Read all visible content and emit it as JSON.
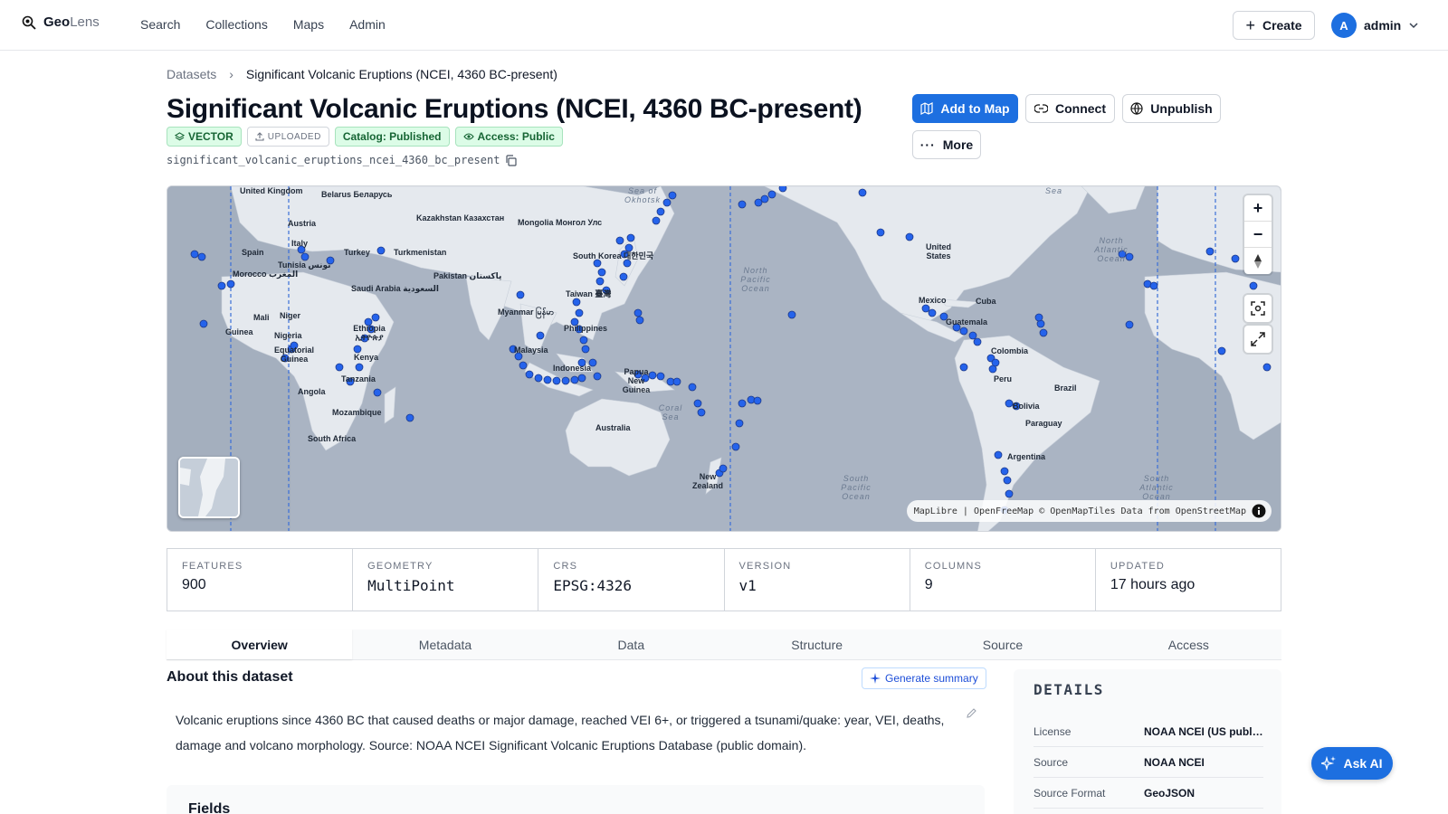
{
  "app": {
    "logo_geo": "Geo",
    "logo_lens": "Lens"
  },
  "nav": {
    "items": [
      "Search",
      "Collections",
      "Maps",
      "Admin"
    ],
    "create_label": "Create",
    "user_initial": "A",
    "user_name": "admin"
  },
  "breadcrumb": {
    "parent": "Datasets",
    "current": "Significant Volcanic Eruptions (NCEI, 4360 BC-present)"
  },
  "dataset": {
    "title": "Significant Volcanic Eruptions (NCEI, 4360 BC-present)",
    "badges": {
      "vector": "VECTOR",
      "uploaded": "UPLOADED",
      "catalog": "Catalog: Published",
      "access": "Access: Public"
    },
    "slug": "significant_volcanic_eruptions_ncei_4360_bc_present"
  },
  "actions": {
    "add_to_map": "Add to Map",
    "connect": "Connect",
    "unpublish": "Unpublish",
    "more": "More"
  },
  "map": {
    "attribution": "MapLibre | OpenFreeMap © OpenMapTiles Data from OpenStreetMap",
    "labels": [
      "United Kingdom",
      "Belarus Беларусь",
      "Austria",
      "Kazakhstan Казахстан",
      "Mongolia Монгол Улс",
      "Spain",
      "Italy",
      "Turkey",
      "Turkmenistan",
      "Morocco المغرب",
      "Tunisia تونس",
      "Saudi Arabia السعودية",
      "Pakistan پاکستان",
      "South Korea 대한민국",
      "Taiwan 臺灣",
      "Myanmar မြန်မာ",
      "Philippines",
      "Malaysia",
      "Indonesia",
      "Papua New Guinea",
      "Mali",
      "Niger",
      "Nigeria",
      "Ethiopia ኢትዮጵያ",
      "Guinea",
      "Equatorial Guinea",
      "Kenya",
      "Tanzania",
      "Angola",
      "Mozambique",
      "South Africa",
      "Australia",
      "New Zealand",
      "United States",
      "Mexico",
      "Cuba",
      "Guatemala",
      "Colombia",
      "Peru",
      "Brazil",
      "Bolivia",
      "Paraguay",
      "Argentina"
    ],
    "oceans": [
      "Sea of Okhotsk",
      "North Pacific Ocean",
      "Coral Sea",
      "South Pacific Ocean",
      "North Atlantic Ocean",
      "South Atlantic Ocean",
      "Sea"
    ]
  },
  "stats": [
    {
      "label": "FEATURES",
      "value": "900"
    },
    {
      "label": "GEOMETRY",
      "value": "MultiPoint"
    },
    {
      "label": "CRS",
      "value": "EPSG:4326"
    },
    {
      "label": "VERSION",
      "value": "v1"
    },
    {
      "label": "COLUMNS",
      "value": "9"
    },
    {
      "label": "UPDATED",
      "value": "17 hours ago"
    }
  ],
  "tabs": [
    "Overview",
    "Metadata",
    "Data",
    "Structure",
    "Source",
    "Access"
  ],
  "about": {
    "heading": "About this dataset",
    "generate_label": "Generate summary",
    "text": "Volcanic eruptions since 4360 BC that caused deaths or major damage, reached VEI 6+, or triggered a tsunami/quake: year, VEI, deaths, damage and volcano morphology. Source: NOAA NCEI Significant Volcanic Eruptions Database (public domain).",
    "fields_heading": "Fields"
  },
  "details": {
    "heading": "DETAILS",
    "rows": [
      {
        "key": "License",
        "value": "NOAA NCEI (US publi..."
      },
      {
        "key": "Source",
        "value": "NOAA NCEI"
      },
      {
        "key": "Source Format",
        "value": "GeoJSON"
      }
    ]
  },
  "ask_ai": "Ask AI",
  "colors": {
    "accent": "#1d6fe0",
    "point": "#2563eb",
    "land": "#e5e9ee",
    "water": "#aab4c3"
  }
}
